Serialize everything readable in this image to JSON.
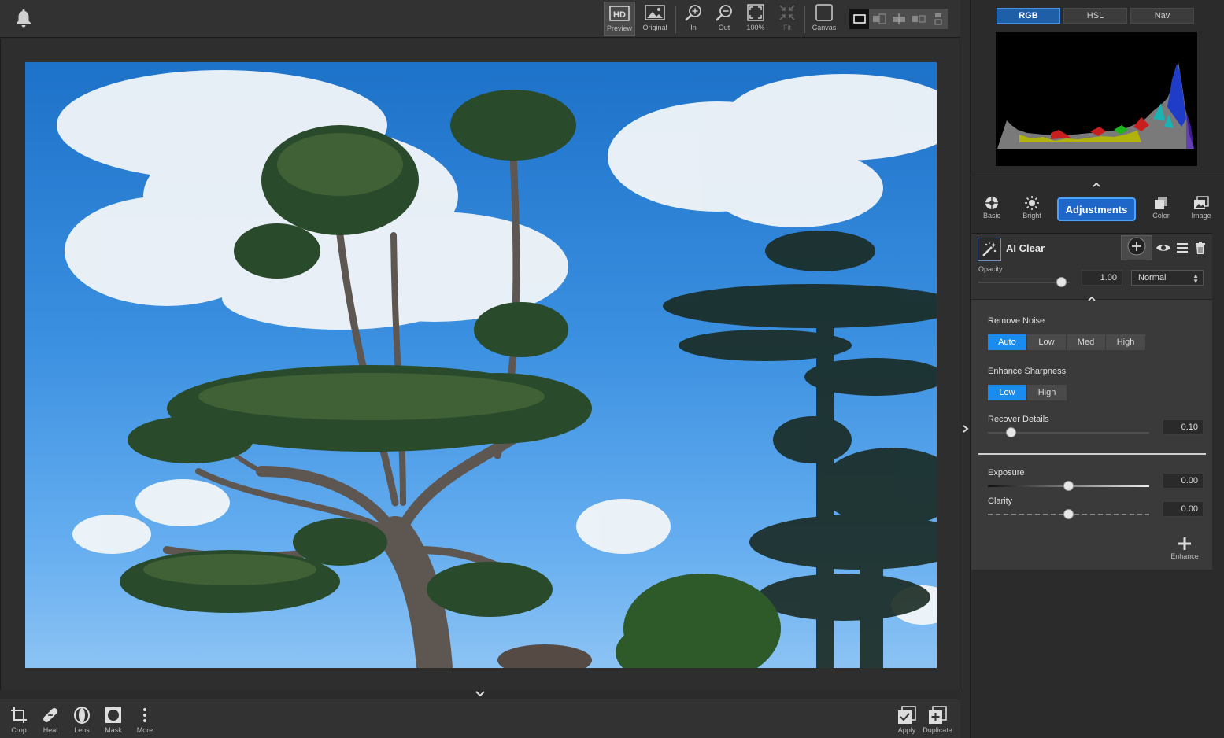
{
  "toolbar": {
    "preview": "Preview",
    "original": "Original",
    "zoom_in": "In",
    "zoom_out": "Out",
    "zoom_100": "100%",
    "fit": "Fit",
    "canvas": "Canvas"
  },
  "bottom_toolbar": {
    "crop": "Crop",
    "heal": "Heal",
    "lens": "Lens",
    "mask": "Mask",
    "more": "More",
    "apply": "Apply",
    "duplicate": "Duplicate"
  },
  "right_panel": {
    "tabs": [
      "RGB",
      "HSL",
      "Nav"
    ],
    "active_tab": "RGB",
    "categories": {
      "basic": "Basic",
      "bright": "Bright",
      "adjustments": "Adjustments",
      "color": "Color",
      "image": "Image"
    },
    "filter": {
      "title": "AI Clear",
      "opacity_label": "Opacity",
      "opacity_value": "1.00",
      "opacity_fraction": 1.0,
      "blend_mode": "Normal",
      "remove_noise_label": "Remove Noise",
      "remove_noise_options": [
        "Auto",
        "Low",
        "Med",
        "High"
      ],
      "remove_noise_selected": "Auto",
      "enhance_sharpness_label": "Enhance Sharpness",
      "enhance_sharpness_options": [
        "Low",
        "High"
      ],
      "enhance_sharpness_selected": "Low",
      "recover_details_label": "Recover Details",
      "recover_details_value": "0.10",
      "exposure_label": "Exposure",
      "exposure_value": "0.00",
      "clarity_label": "Clarity",
      "clarity_value": "0.00",
      "enhance_label": "Enhance"
    }
  },
  "colors": {
    "accent_blue": "#1a8cf0",
    "panel_bg": "#3a3a3a",
    "app_bg": "#2b2b2b"
  },
  "icons": [
    "bell-icon",
    "hd-icon",
    "image-icon",
    "zoom-in-icon",
    "zoom-out-icon",
    "fullscreen-icon",
    "fit-icon",
    "canvas-icon",
    "crop-icon",
    "bandage-icon",
    "lens-icon",
    "mask-icon",
    "more-dots-icon",
    "apply-icon",
    "duplicate-icon",
    "aperture-icon",
    "sun-icon",
    "layers-icon",
    "gallery-icon",
    "magic-wand-icon",
    "plus-icon",
    "eye-icon",
    "menu-icon",
    "trash-icon"
  ]
}
